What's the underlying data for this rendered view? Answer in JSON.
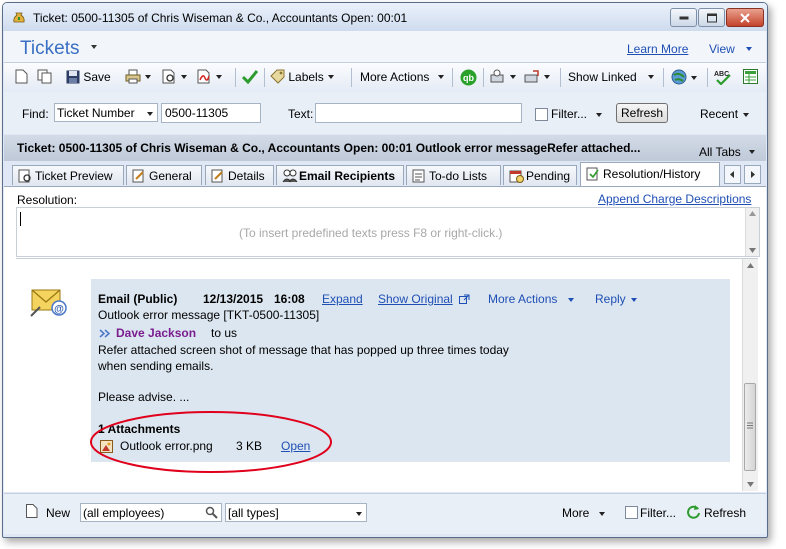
{
  "window": {
    "title": "Ticket: 0500-11305 of Chris Wiseman & Co., Accountants Open:  00:01"
  },
  "header": {
    "title": "Tickets",
    "learn_more": "Learn More",
    "view": "View"
  },
  "toolbar": {
    "save": "Save",
    "labels": "Labels",
    "more_actions": "More Actions",
    "show_linked": "Show Linked"
  },
  "find": {
    "label": "Find:",
    "field": "Ticket Number",
    "value": "0500-11305",
    "text_label": "Text:",
    "text_value": "",
    "filter": "Filter...",
    "refresh": "Refresh",
    "recent": "Recent"
  },
  "ticket_bar": {
    "text": "Ticket: 0500-11305 of Chris Wiseman & Co., Accountants Open:  00:01 Outlook error messageRefer attached...",
    "all_tabs": "All Tabs"
  },
  "tabs": [
    {
      "label": "Ticket Preview"
    },
    {
      "label": "General"
    },
    {
      "label": "Details"
    },
    {
      "label": "Email Recipients"
    },
    {
      "label": "To-do Lists"
    },
    {
      "label": "Pending"
    },
    {
      "label": "Resolution/History"
    }
  ],
  "resolution": {
    "label": "Resolution:",
    "append_link": "Append Charge Descriptions",
    "placeholder": "(To insert predefined texts press F8 or right-click.)"
  },
  "email": {
    "type": "Email (Public)",
    "date": "12/13/2015",
    "time": "16:08",
    "expand": "Expand",
    "show_original": "Show Original",
    "more_actions": "More Actions",
    "reply": "Reply",
    "subject": "Outlook error message [TKT-0500-11305]",
    "from": "Dave Jackson",
    "to": "to us",
    "body_line1": "Refer attached screen shot of message that has popped up three times today",
    "body_line2": "when sending emails.",
    "body_line3": "Please advise. ...",
    "attachments_title": "1 Attachments",
    "attachment_name": "Outlook error.png",
    "attachment_size": "3 KB",
    "attachment_open": "Open"
  },
  "bottom": {
    "new": "New",
    "employees": "(all employees)",
    "types": "[all types]",
    "more": "More",
    "filter": "Filter...",
    "refresh": "Refresh"
  },
  "colors": {
    "accent_blue": "#3a6fc3",
    "link_blue": "#1f4fb4",
    "sender_purple": "#7a1d8f",
    "highlight_red": "#e0001b",
    "card_bg": "#dce6f0"
  }
}
